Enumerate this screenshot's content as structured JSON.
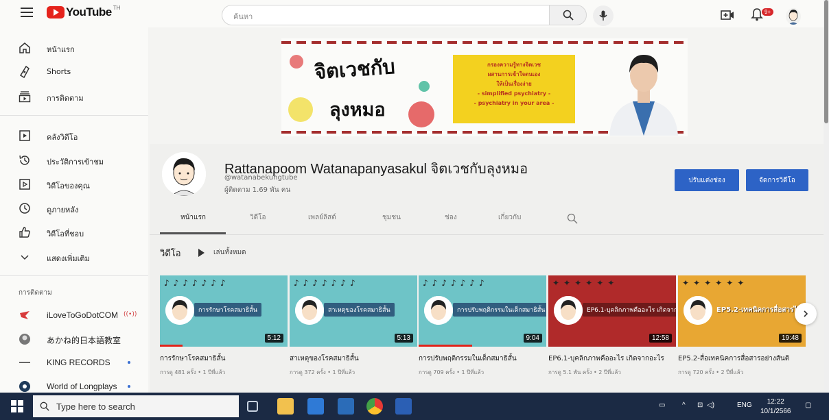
{
  "app": {
    "logo_text": "YouTube",
    "logo_sup": "TH"
  },
  "search": {
    "placeholder": "ค้นหา"
  },
  "notifications": {
    "badge": "9+"
  },
  "sidebar": {
    "items": [
      {
        "label": "หน้าแรก",
        "icon": "home-icon"
      },
      {
        "label": "Shorts",
        "icon": "shorts-icon"
      },
      {
        "label": "การติดตาม",
        "icon": "subscriptions-icon"
      },
      {
        "label": "คลังวิดีโอ",
        "icon": "library-icon"
      },
      {
        "label": "ประวัติการเข้าชม",
        "icon": "history-icon"
      },
      {
        "label": "วิดีโอของคุณ",
        "icon": "your-videos-icon"
      },
      {
        "label": "ดูภายหลัง",
        "icon": "watch-later-icon"
      },
      {
        "label": "วิดีโอที่ชอบ",
        "icon": "liked-icon"
      },
      {
        "label": "แสดงเพิ่มเติม",
        "icon": "chevron-down-icon"
      }
    ],
    "subscriptions_heading": "การติดตาม",
    "subscriptions": [
      {
        "name": "iLoveToGoDotCOM",
        "indicator": "live"
      },
      {
        "name": "あかね的日本語教室",
        "indicator": ""
      },
      {
        "name": "KING RECORDS",
        "indicator": "dot"
      },
      {
        "name": "World of Longplays",
        "indicator": "dot"
      }
    ]
  },
  "banner": {
    "title_line1": "จิตเวชกับ",
    "title_line2": "ลุงหมอ",
    "box_lines": [
      "กรองความรู้ทางจิตเวช",
      "ผสานการเข้าใจตนเอง",
      "ให้เป็นเรื่องง่าย",
      "- simplified psychiatry -",
      "- psychiatry in your area -"
    ]
  },
  "channel": {
    "name": "Rattanapoom Watanapanyasakul จิตเวชกับลุงหมอ",
    "handle": "@watanabekungtube",
    "subscribers": "ผู้ติดตาม 1.69 พัน คน",
    "customize_label": "ปรับแต่งช่อง",
    "manage_label": "จัดการวิดีโอ"
  },
  "tabs": [
    "หน้าแรก",
    "วิดีโอ",
    "เพลย์ลิสต์",
    "ชุมชน",
    "ช่อง",
    "เกี่ยวกับ"
  ],
  "videos_section": {
    "title": "วิดีโอ",
    "play_all": "เล่นทั้งหมด"
  },
  "videos": [
    {
      "title": "การรักษาโรคสมาธิสั้น",
      "meta": "การดู 481 ครั้ง • 1 ปีที่แล้ว",
      "duration": "5:12",
      "thumb_text": "การรักษาโรคสมาธิสั้น",
      "theme": "teal",
      "progress": 0.18
    },
    {
      "title": "สาเหตุของโรคสมาธิสั้น",
      "meta": "การดู 372 ครั้ง • 1 ปีที่แล้ว",
      "duration": "5:13",
      "thumb_text": "สาเหตุของโรคสมาธิสั้น",
      "theme": "teal",
      "progress": 0.0
    },
    {
      "title": "การปรับพฤติกรรมในเด็กสมาธิสั้น",
      "meta": "การดู 709 ครั้ง • 1 ปีที่แล้ว",
      "duration": "9:04",
      "thumb_text": "การปรับพฤติกรรมในเด็กสมาธิสั้น",
      "theme": "teal",
      "progress": 0.42
    },
    {
      "title": "EP6.1-บุคลิกภาพคืออะไร เกิดจากอะไร",
      "meta": "การดู 5.1 พัน ครั้ง • 2 ปีที่แล้ว",
      "duration": "12:58",
      "thumb_text": "EP6.1-บุคลิกภาพคืออะไร เกิดจากอะไร",
      "theme": "red",
      "progress": 0.0
    },
    {
      "title": "EP5.2-สื่อเทคนิคการสื่อสารอย่างสันติ",
      "meta": "การดู 720 ครั้ง • 2 ปีที่แล้ว",
      "duration": "19:48",
      "thumb_text": "EP5.2-เทคนิคการสื่อสารไม่สันติ",
      "theme": "orange",
      "progress": 0.0
    }
  ],
  "taskbar": {
    "search_placeholder": "Type here to search",
    "lang": "ENG",
    "time": "12:22",
    "date": "10/1/2566"
  },
  "colors": {
    "brand_red": "#e5231c",
    "button_blue": "#2d63c6",
    "taskbar": "#1b2a44"
  }
}
